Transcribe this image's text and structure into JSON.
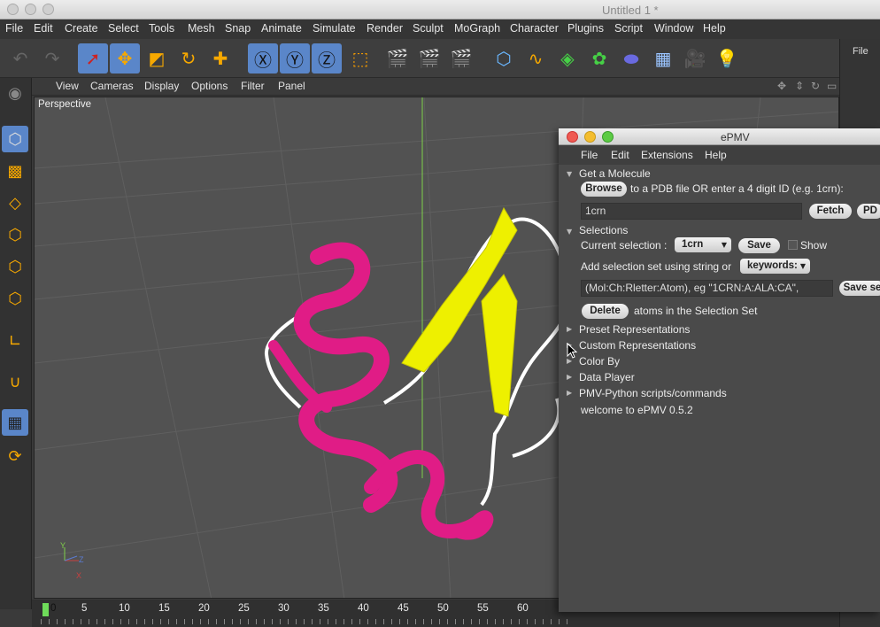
{
  "window": {
    "title": "Untitled 1 *"
  },
  "menubar": [
    "File",
    "Edit",
    "Create",
    "Select",
    "Tools",
    "Mesh",
    "Snap",
    "Animate",
    "Simulate",
    "Render",
    "Sculpt",
    "MoGraph",
    "Character",
    "Plugins",
    "Script",
    "Window",
    "Help"
  ],
  "right_strip": {
    "label": "File"
  },
  "viewport": {
    "menu": [
      "View",
      "Cameras",
      "Display",
      "Options",
      "Filter",
      "Panel"
    ],
    "label": "Perspective",
    "axis_y": "Y",
    "axis_z": "Z",
    "axis_x": "X"
  },
  "timeline": {
    "ticks": [
      "0",
      "5",
      "10",
      "15",
      "20",
      "25",
      "30",
      "35",
      "40",
      "45",
      "50",
      "55",
      "60"
    ]
  },
  "colors": {
    "accent": "#5a86c9",
    "helix": "#e01c86",
    "strand": "#eef000",
    "coil": "#ffffff"
  },
  "panel": {
    "title": "ePMV",
    "menu": [
      "File",
      "Edit",
      "Extensions",
      "Help"
    ],
    "get_molecule": "Get a Molecule",
    "browse": "Browse",
    "browse_hint": "to a PDB file OR enter a 4 digit ID (e.g. 1crn):",
    "id_value": "1crn",
    "fetch": "Fetch",
    "pd_btn": "PD",
    "selections": "Selections",
    "current_selection_label": "Current selection :",
    "current_selection_value": "1crn",
    "save": "Save",
    "show": "Show",
    "add_set_label": "Add selection set using string or",
    "keywords": "keywords:",
    "selection_string": "(Mol:Ch:Rletter:Atom), eg \"1CRN:A:ALA:CA\",",
    "save_set": "Save se",
    "delete": "Delete",
    "delete_hint": "atoms in the Selection Set",
    "sections": [
      "Preset Representations",
      "Custom Representations",
      "Color By",
      "Data Player",
      "PMV-Python scripts/commands"
    ],
    "welcome": "welcome to ePMV 0.5.2"
  }
}
